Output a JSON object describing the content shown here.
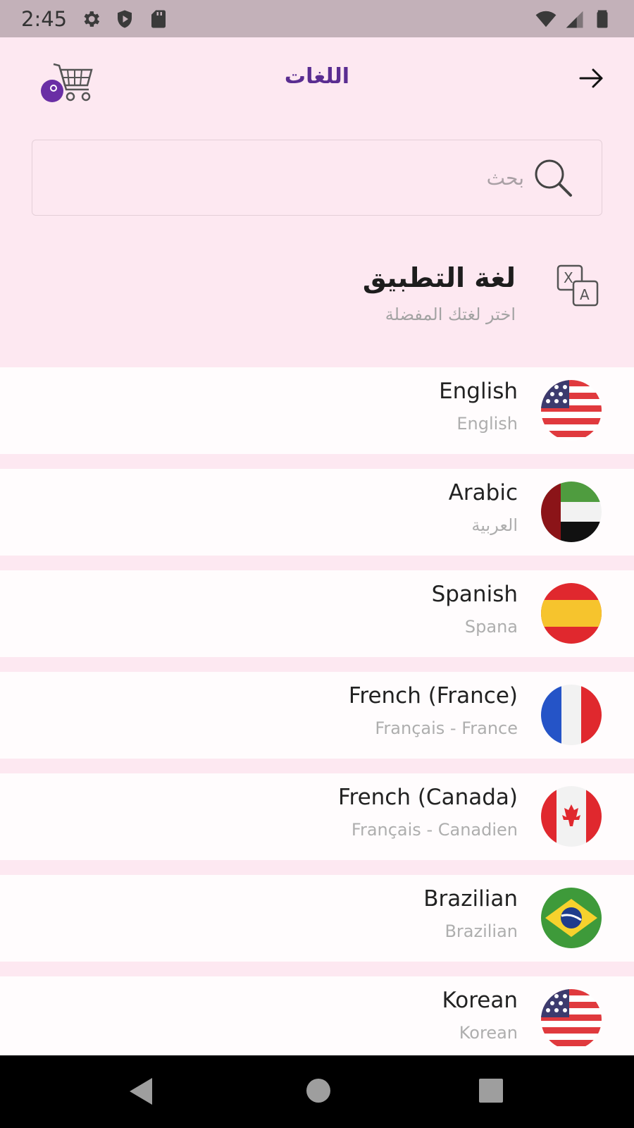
{
  "status_bar": {
    "time": "2:45",
    "left_icons": [
      "gear-icon",
      "shield-icon",
      "sd-card-icon"
    ],
    "right_icons": [
      "wifi-icon",
      "signal-icon",
      "battery-icon"
    ]
  },
  "header": {
    "title": "اللغات",
    "logo_icon": "cart-logo-icon",
    "back_icon": "arrow-right-icon"
  },
  "search": {
    "placeholder": "بحث",
    "value": ""
  },
  "app_language": {
    "title": "لغة التطبيق",
    "subtitle": "اختر لغتك المفضلة",
    "icon": "translate-icon"
  },
  "languages": [
    {
      "name": "English",
      "native": "English",
      "flag": "usa"
    },
    {
      "name": "Arabic",
      "native": "العربية",
      "flag": "uae"
    },
    {
      "name": "Spanish",
      "native": "Spana",
      "flag": "spain"
    },
    {
      "name": "French (France)",
      "native": "Français - France",
      "flag": "france"
    },
    {
      "name": "French (Canada)",
      "native": "Français - Canadien",
      "flag": "canada"
    },
    {
      "name": "Brazilian",
      "native": "Brazilian",
      "flag": "brazil"
    },
    {
      "name": "Korean",
      "native": "Korean",
      "flag": "usa"
    }
  ],
  "colors": {
    "background": "#fde8f1",
    "row_background": "#fffcfd",
    "title_purple": "#5a2d91",
    "status_bar": "#c3b1b9"
  }
}
